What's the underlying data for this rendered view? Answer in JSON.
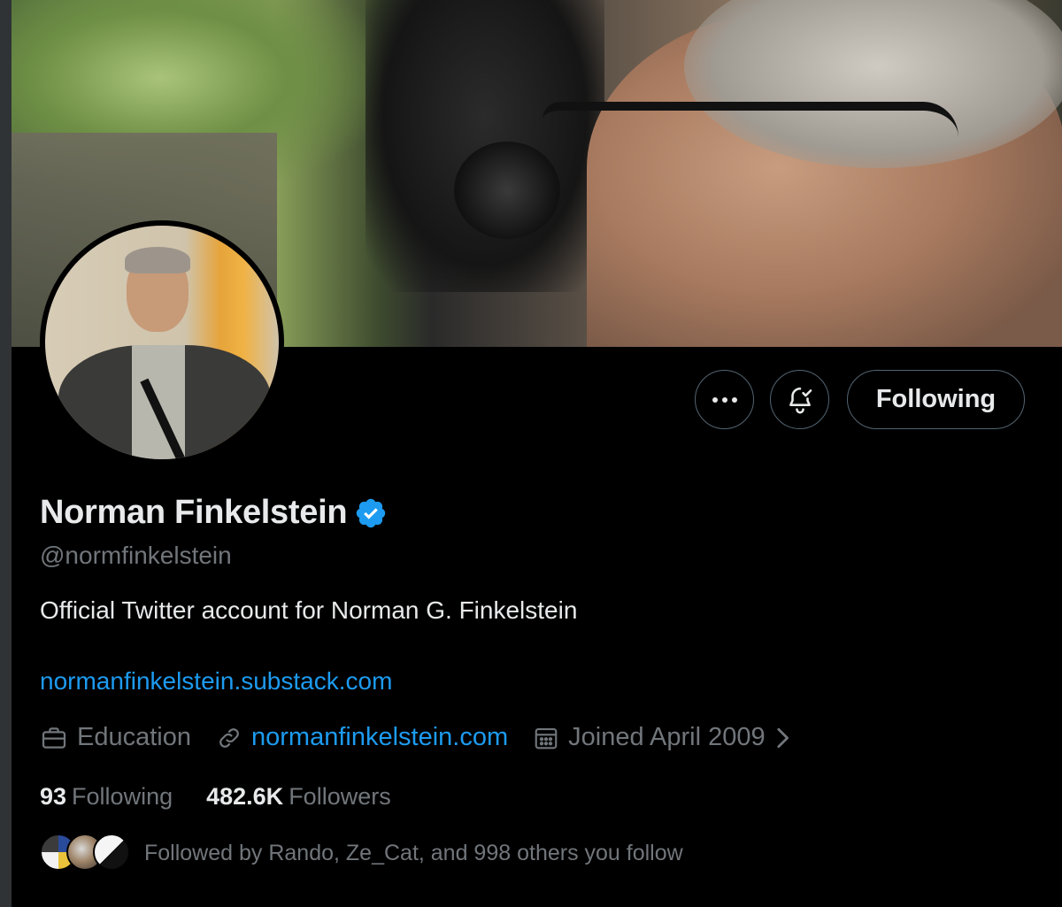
{
  "profile": {
    "name": "Norman Finkelstein",
    "handle": "@normfinkelstein",
    "bio": "Official Twitter account for Norman G. Finkelstein",
    "bio_link": "normanfinkelstein.substack.com",
    "category": "Education",
    "website": "normanfinkelstein.com",
    "joined": "Joined April 2009",
    "verified": true
  },
  "actions": {
    "follow_label": "Following"
  },
  "stats": {
    "following_count": "93",
    "following_label": "Following",
    "followers_count": "482.6K",
    "followers_label": "Followers"
  },
  "followed_by": {
    "text": "Followed by Rando, Ze_Cat, and 998 others you follow"
  },
  "colors": {
    "background": "#000000",
    "accent": "#1d9bf0",
    "text_primary": "#e7e9ea",
    "text_secondary": "#71767b",
    "border": "#536471"
  },
  "icons": [
    "more-icon",
    "bell-check-icon",
    "verified-badge-icon",
    "briefcase-icon",
    "link-icon",
    "calendar-icon",
    "chevron-right-icon"
  ]
}
